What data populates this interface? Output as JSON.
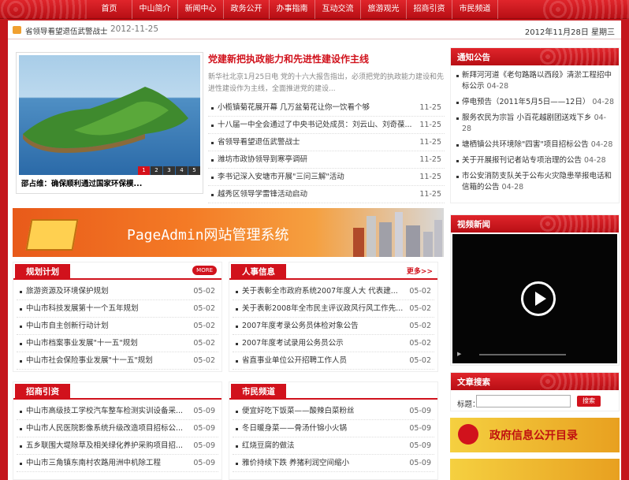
{
  "nav": {
    "items": [
      "首页",
      "中山简介",
      "新闻中心",
      "政务公开",
      "办事指南",
      "互动交流",
      "旅游观光",
      "招商引资",
      "市民频道"
    ]
  },
  "ticker": {
    "text": "省领导看望退伍武警战士",
    "date": "2012-11-25",
    "today": "2012年11月28日 星期三"
  },
  "focus": {
    "caption": "邵占维：确保顺利通过国家环保模...",
    "nums": [
      "1",
      "2",
      "3",
      "4",
      "5"
    ]
  },
  "headline": {
    "title": "党建新把执政能力和先进性建设作主线",
    "summary": "新华社北京1月25日电 党的十六大报告指出，必须把党的执政能力建设和先进性建设作为主线，全面推进党的建设..."
  },
  "news": [
    {
      "title": "小榄镇菊花展开幕 几万盆菊花让你一饮看个够",
      "date": "11-25"
    },
    {
      "title": "十八届一中全会通过了中央书记处成员：刘云山、刘奇葆...",
      "date": "11-25"
    },
    {
      "title": "省领导看望退伍武警战士",
      "date": "11-25"
    },
    {
      "title": "潍坊市政协领导到寒亭调研",
      "date": "11-25"
    },
    {
      "title": "李书记深入安塘市开展\"三问三解\"活动",
      "date": "11-25"
    },
    {
      "title": "越秀区领导学雷锋活动启动",
      "date": "11-25"
    }
  ],
  "banner": {
    "text": "PageAdmin网站管理系统"
  },
  "plan": {
    "title": "规划计划",
    "more": "MORE",
    "items": [
      {
        "title": "旅游资源及环境保护规划",
        "date": "05-02"
      },
      {
        "title": "中山市科技发展第十一个五年规划",
        "date": "05-02"
      },
      {
        "title": "中山市自主创新行动计划",
        "date": "05-02"
      },
      {
        "title": "中山市档案事业发展\"十一五\"规划",
        "date": "05-02"
      },
      {
        "title": "中山市社会保险事业发展\"十一五\"规划",
        "date": "05-02"
      }
    ]
  },
  "hr": {
    "title": "人事信息",
    "more": "更多>>",
    "items": [
      {
        "title": "关于表彰全市政府系统2007年度人大 代表建...",
        "date": "05-02"
      },
      {
        "title": "关于表彰2008年全市民主评议政风行风工作先...",
        "date": "05-02"
      },
      {
        "title": "2007年度考录公务员体检对象公告",
        "date": "05-02"
      },
      {
        "title": "2007年度考试录用公务员公示",
        "date": "05-02"
      },
      {
        "title": "省直事业单位公开招聘工作人员",
        "date": "05-02"
      }
    ]
  },
  "invest": {
    "title": "招商引资",
    "items": [
      {
        "title": "中山市高级技工学校汽车整车检测实训设备采...",
        "date": "05-09"
      },
      {
        "title": "中山市人民医院影像系统升级改造项目招标公...",
        "date": "05-09"
      },
      {
        "title": "五乡联围大堤除草及相关绿化养护采购项目招...",
        "date": "05-09"
      },
      {
        "title": "中山市三角镇东南村农路用洲中机除工程",
        "date": "05-09"
      }
    ]
  },
  "citizen": {
    "title": "市民频道",
    "items": [
      {
        "title": "便宜好吃下饭菜——酸辣白菜粉丝",
        "date": "05-09"
      },
      {
        "title": "冬日暖身菜——骨汤什锦小火锅",
        "date": "05-09"
      },
      {
        "title": "红烧豆腐的做法",
        "date": "05-09"
      },
      {
        "title": "雅价持续下跌 养猪利润空间缩小",
        "date": "05-09"
      }
    ]
  },
  "notice": {
    "title": "通知公告",
    "items": [
      {
        "title": "新拜河河道《老句路路以西段》清淤工程招中标公示",
        "date": "04-28"
      },
      {
        "title": "停电预告（2011年5月5日——12日）",
        "date": "04-28"
      },
      {
        "title": "服务农民为宗旨 小百花越剧团送戏下乡",
        "date": "04-28"
      },
      {
        "title": "塘栖镇公共环境除\"四害\"项目招标公告",
        "date": "04-28"
      },
      {
        "title": "关于开展报刊记者站专项治理的公告",
        "date": "04-28"
      },
      {
        "title": "市公安消防支队关于公布火灾隐患举报电话和信箱的公告",
        "date": "04-28"
      }
    ]
  },
  "video": {
    "title": "视频新闻"
  },
  "search": {
    "title": "文章搜索",
    "label": "标题：",
    "button": "搜索",
    "placeholder": ""
  },
  "gov": {
    "text": "政府信息公开目录"
  }
}
